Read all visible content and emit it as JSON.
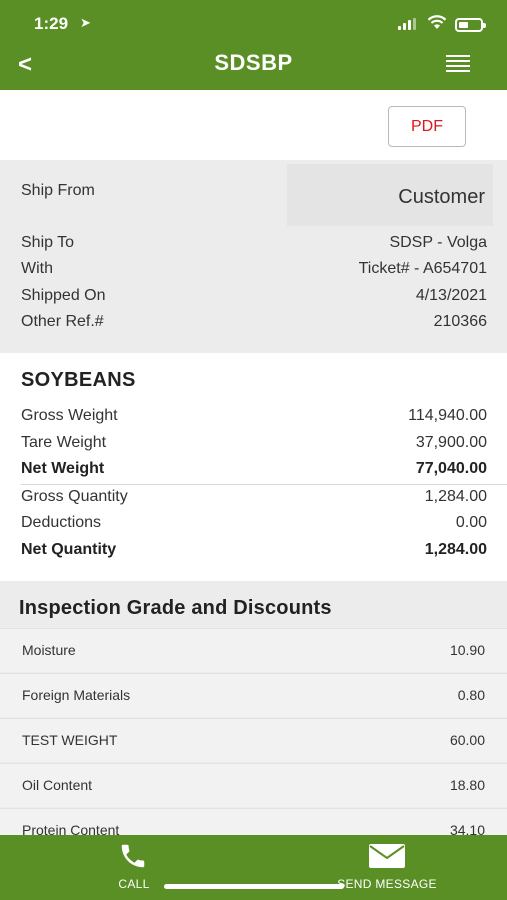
{
  "status": {
    "time": "1:29",
    "location_glyph": "➤"
  },
  "nav": {
    "back_glyph": "<",
    "title": "SDSBP"
  },
  "actions": {
    "pdf_label": "PDF"
  },
  "shipping": {
    "ship_from_label": "Ship From",
    "ship_from_value": "Customer",
    "rows": [
      {
        "label": "Ship To",
        "value": "SDSP - Volga"
      },
      {
        "label": "With",
        "value": "Ticket# - A654701"
      },
      {
        "label": "Shipped On",
        "value": "4/13/2021"
      },
      {
        "label": "Other Ref.#",
        "value": "210366"
      }
    ]
  },
  "commodity": {
    "name": "SOYBEANS",
    "weights": [
      {
        "label": "Gross Weight",
        "value": "114,940.00"
      },
      {
        "label": "Tare Weight",
        "value": "37,900.00"
      },
      {
        "label": "Net Weight",
        "value": "77,040.00"
      }
    ],
    "quantities": [
      {
        "label": "Gross Quantity",
        "value": "1,284.00"
      },
      {
        "label": "Deductions",
        "value": "0.00"
      },
      {
        "label": "Net Quantity",
        "value": "1,284.00"
      }
    ]
  },
  "inspection": {
    "title": "Inspection Grade and Discounts",
    "grades": [
      {
        "label": "Moisture",
        "value": "10.90"
      },
      {
        "label": "Foreign Materials",
        "value": "0.80"
      },
      {
        "label": "TEST WEIGHT",
        "value": "60.00"
      },
      {
        "label": "Oil Content",
        "value": "18.80"
      },
      {
        "label": "Protein Content",
        "value": "34.10"
      }
    ]
  },
  "tabbar": {
    "call_label": "CALL",
    "message_label": "SEND MESSAGE"
  },
  "colors": {
    "brand_green": "#5a8f25",
    "pdf_red": "#e0161d",
    "section_gray": "#ececec"
  }
}
